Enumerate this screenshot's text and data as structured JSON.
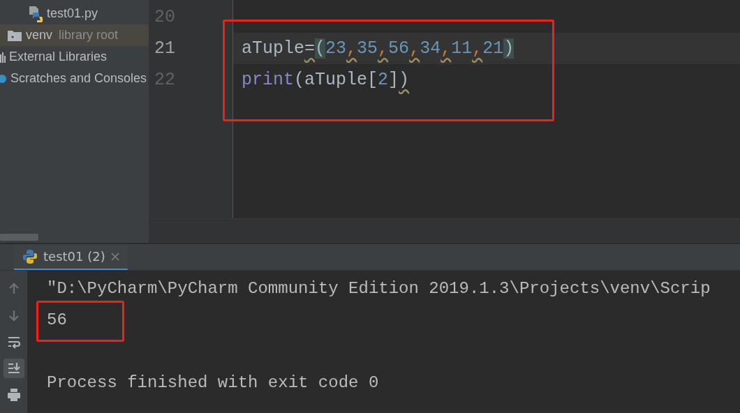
{
  "project_tree": {
    "items": [
      {
        "kind": "python-file",
        "label": "test01.py",
        "selected": false
      },
      {
        "kind": "folder",
        "label": "venv",
        "note": "library root",
        "selected": true
      },
      {
        "kind": "library",
        "label": "External Libraries",
        "selected": false
      },
      {
        "kind": "scratches",
        "label": "Scratches and Consoles",
        "selected": false
      }
    ]
  },
  "editor": {
    "lines": [
      {
        "number": "20",
        "current": false
      },
      {
        "number": "21",
        "current": true,
        "tokens": [
          {
            "kind": "name",
            "text": "aTuple"
          },
          {
            "kind": "operator",
            "text": "=",
            "squiggle": true
          },
          {
            "kind": "paren",
            "text": "(",
            "matched": true
          },
          {
            "kind": "number",
            "text": "23"
          },
          {
            "kind": "comma",
            "text": ",",
            "squiggle": true
          },
          {
            "kind": "number",
            "text": "35"
          },
          {
            "kind": "comma",
            "text": ",",
            "squiggle": true
          },
          {
            "kind": "number",
            "text": "56"
          },
          {
            "kind": "comma",
            "text": ",",
            "squiggle": true
          },
          {
            "kind": "number",
            "text": "34"
          },
          {
            "kind": "comma",
            "text": ",",
            "squiggle": true
          },
          {
            "kind": "number",
            "text": "11"
          },
          {
            "kind": "comma",
            "text": ",",
            "squiggle": true
          },
          {
            "kind": "number",
            "text": "21"
          },
          {
            "kind": "paren",
            "text": ")",
            "matched": true
          }
        ]
      },
      {
        "number": "22",
        "current": false,
        "tokens": [
          {
            "kind": "builtin",
            "text": "print"
          },
          {
            "kind": "paren",
            "text": "(",
            "matched": false
          },
          {
            "kind": "name",
            "text": "aTuple"
          },
          {
            "kind": "paren",
            "text": "[",
            "matched": false
          },
          {
            "kind": "number",
            "text": "2"
          },
          {
            "kind": "paren",
            "text": "]",
            "matched": false
          },
          {
            "kind": "paren",
            "text": ")",
            "matched": false,
            "squiggle": true
          }
        ]
      }
    ]
  },
  "run_panel": {
    "tabs": [
      {
        "label": "test01 (2)",
        "selected": true
      }
    ],
    "tools": [
      {
        "kind": "up",
        "selected": false
      },
      {
        "kind": "down",
        "selected": false
      },
      {
        "kind": "wrap",
        "selected": false
      },
      {
        "kind": "scroll-end",
        "selected": true
      },
      {
        "kind": "print",
        "selected": false
      }
    ],
    "output": [
      {
        "kind": "command",
        "text": "\"D:\\PyCharm\\PyCharm Community Edition 2019.1.3\\Projects\\venv\\Scrip"
      },
      {
        "kind": "output",
        "text": "56"
      },
      {
        "kind": "exit",
        "text": "Process finished with exit code 0"
      }
    ]
  }
}
